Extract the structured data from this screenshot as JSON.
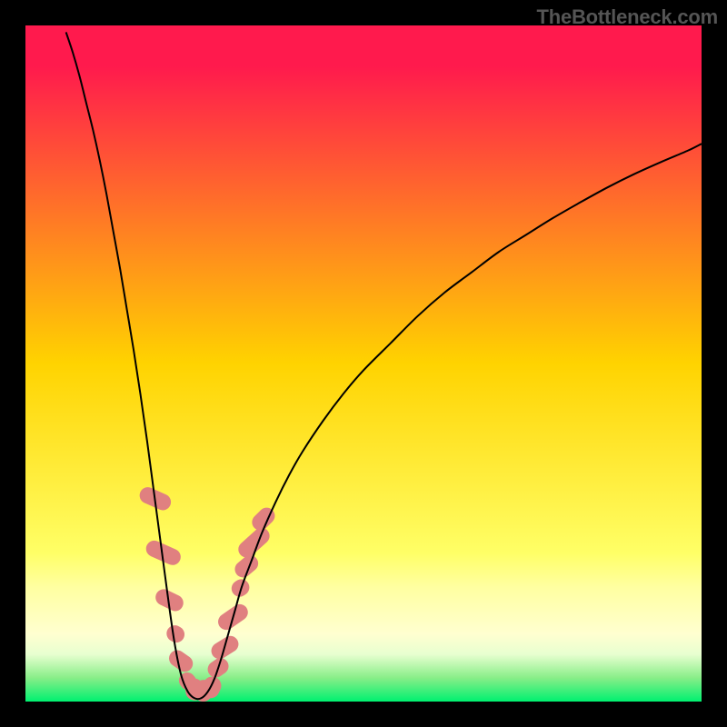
{
  "watermark": "TheBottleneck.com",
  "chart_data": {
    "type": "line",
    "title": "",
    "xlabel": "",
    "ylabel": "",
    "xlim": [
      0,
      100
    ],
    "ylim": [
      0,
      100
    ],
    "background_gradient": {
      "stops": [
        {
          "offset": 0.0,
          "color": "#ff1a4d"
        },
        {
          "offset": 0.06,
          "color": "#ff1a4d"
        },
        {
          "offset": 0.5,
          "color": "#ffd300"
        },
        {
          "offset": 0.78,
          "color": "#ffff66"
        },
        {
          "offset": 0.83,
          "color": "#ffffa0"
        },
        {
          "offset": 0.9,
          "color": "#ffffd0"
        },
        {
          "offset": 0.93,
          "color": "#e8ffd0"
        },
        {
          "offset": 0.965,
          "color": "#88ee88"
        },
        {
          "offset": 1.0,
          "color": "#00f070"
        }
      ]
    },
    "series": [
      {
        "name": "bottleneck-curve",
        "color": "#000000",
        "width": 2.0,
        "points": [
          [
            6.0,
            99.0
          ],
          [
            7.0,
            96.0
          ],
          [
            8.0,
            92.5
          ],
          [
            9.0,
            88.5
          ],
          [
            10.0,
            84.5
          ],
          [
            11.0,
            80.0
          ],
          [
            12.0,
            75.0
          ],
          [
            13.0,
            69.5
          ],
          [
            14.0,
            64.0
          ],
          [
            15.0,
            58.0
          ],
          [
            16.0,
            52.0
          ],
          [
            17.0,
            45.5
          ],
          [
            18.0,
            38.5
          ],
          [
            19.0,
            31.0
          ],
          [
            20.0,
            23.5
          ],
          [
            21.0,
            16.0
          ],
          [
            22.0,
            9.0
          ],
          [
            23.0,
            4.0
          ],
          [
            24.0,
            1.5
          ],
          [
            25.0,
            0.5
          ],
          [
            26.0,
            0.5
          ],
          [
            27.0,
            1.5
          ],
          [
            28.0,
            3.5
          ],
          [
            29.0,
            6.5
          ],
          [
            30.0,
            10.0
          ],
          [
            31.0,
            13.5
          ],
          [
            32.0,
            17.0
          ],
          [
            33.5,
            21.0
          ],
          [
            35.0,
            25.0
          ],
          [
            37.0,
            29.5
          ],
          [
            39.0,
            33.5
          ],
          [
            41.0,
            37.0
          ],
          [
            44.0,
            41.5
          ],
          [
            47.0,
            45.5
          ],
          [
            50.0,
            49.0
          ],
          [
            54.0,
            53.0
          ],
          [
            58.0,
            57.0
          ],
          [
            62.0,
            60.5
          ],
          [
            66.0,
            63.5
          ],
          [
            70.0,
            66.5
          ],
          [
            74.0,
            69.0
          ],
          [
            78.0,
            71.5
          ],
          [
            82.0,
            73.8
          ],
          [
            86.0,
            76.0
          ],
          [
            90.0,
            78.0
          ],
          [
            94.0,
            79.8
          ],
          [
            98.0,
            81.5
          ],
          [
            100.0,
            82.5
          ]
        ]
      },
      {
        "name": "left-beads",
        "type": "beads",
        "color": "#e08080",
        "points": [
          [
            19.2,
            30.0,
            9,
            18,
            -66
          ],
          [
            20.4,
            22.0,
            9,
            20,
            -66
          ],
          [
            21.3,
            15.0,
            9,
            16,
            -64
          ],
          [
            22.2,
            10.0,
            9,
            10,
            -60
          ],
          [
            23.0,
            6.0,
            9,
            14,
            -55
          ],
          [
            24.0,
            3.0,
            9,
            10,
            -40
          ]
        ]
      },
      {
        "name": "bottom-beads",
        "type": "beads",
        "color": "#e08080",
        "points": [
          [
            25.0,
            1.8,
            10,
            12,
            -5
          ],
          [
            26.3,
            1.6,
            10,
            12,
            5
          ],
          [
            27.5,
            2.1,
            10,
            12,
            25
          ]
        ]
      },
      {
        "name": "right-beads",
        "type": "beads",
        "color": "#e08080",
        "points": [
          [
            28.5,
            5.0,
            9,
            12,
            55
          ],
          [
            29.5,
            8.0,
            9,
            16,
            58
          ],
          [
            30.7,
            12.5,
            9,
            18,
            55
          ],
          [
            31.8,
            16.8,
            9,
            10,
            53
          ],
          [
            32.7,
            20.0,
            9,
            14,
            50
          ],
          [
            33.8,
            23.5,
            9,
            20,
            48
          ],
          [
            35.2,
            27.0,
            9,
            14,
            45
          ]
        ]
      }
    ]
  }
}
